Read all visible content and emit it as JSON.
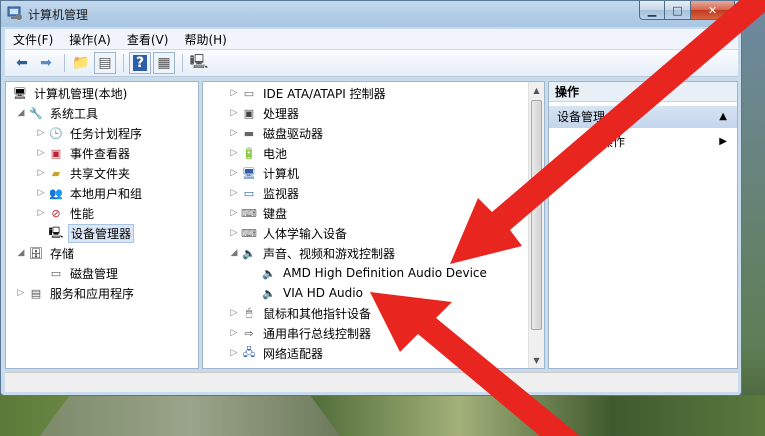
{
  "window": {
    "title": "计算机管理"
  },
  "menu": {
    "items": [
      "文件(F)",
      "操作(A)",
      "查看(V)",
      "帮助(H)"
    ]
  },
  "toolbar": {
    "icons": [
      "back-icon",
      "forward-icon",
      "up-icon",
      "show-hide-tree-icon",
      "help-icon",
      "properties-icon",
      "scan-hardware-icon"
    ]
  },
  "left_tree": {
    "items": [
      {
        "label": "计算机管理(本地)",
        "icon": "computer-manage-icon"
      },
      {
        "label": "系统工具",
        "icon": "tools-icon"
      },
      {
        "label": "任务计划程序",
        "icon": "clock-icon"
      },
      {
        "label": "事件查看器",
        "icon": "event-viewer-icon"
      },
      {
        "label": "共享文件夹",
        "icon": "shared-folder-icon"
      },
      {
        "label": "本地用户和组",
        "icon": "users-icon"
      },
      {
        "label": "性能",
        "icon": "performance-icon"
      },
      {
        "label": "设备管理器",
        "icon": "device-manager-icon"
      },
      {
        "label": "存储",
        "icon": "storage-icon"
      },
      {
        "label": "磁盘管理",
        "icon": "disk-icon"
      },
      {
        "label": "服务和应用程序",
        "icon": "services-icon"
      }
    ]
  },
  "device_tree": {
    "items": [
      {
        "label": "IDE ATA/ATAPI 控制器",
        "icon": "ide-controller-icon"
      },
      {
        "label": "处理器",
        "icon": "processor-icon"
      },
      {
        "label": "磁盘驱动器",
        "icon": "disk-drive-icon"
      },
      {
        "label": "电池",
        "icon": "battery-icon"
      },
      {
        "label": "计算机",
        "icon": "computer-icon"
      },
      {
        "label": "监视器",
        "icon": "monitor-icon"
      },
      {
        "label": "键盘",
        "icon": "keyboard-icon"
      },
      {
        "label": "人体学输入设备",
        "icon": "hid-icon"
      },
      {
        "label": "声音、视频和游戏控制器",
        "icon": "speaker-icon"
      },
      {
        "label": "AMD High Definition Audio Device",
        "icon": "speaker-icon"
      },
      {
        "label": "VIA HD Audio",
        "icon": "speaker-icon"
      },
      {
        "label": "鼠标和其他指针设备",
        "icon": "mouse-icon"
      },
      {
        "label": "通用串行总线控制器",
        "icon": "usb-icon"
      },
      {
        "label": "网络适配器",
        "icon": "network-icon"
      }
    ]
  },
  "actions": {
    "header": "操作",
    "section": "设备管理",
    "more": "多操作"
  },
  "colors": {
    "arrow_red": "#e8251f",
    "selection": "#dbe7f6"
  }
}
